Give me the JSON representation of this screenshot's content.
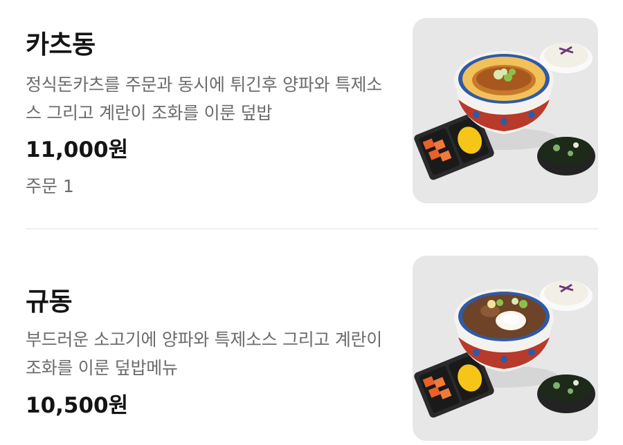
{
  "menu": {
    "items": [
      {
        "name": "카츠동",
        "description": "정식돈카츠를 주문과 동시에 튀긴후 양파와 특제소스 그리고 계란이 조화를 이룬 덮밥",
        "price": "11,000원",
        "orders": "주문 1"
      },
      {
        "name": "규동",
        "description": "부드러운 소고기에 양파와 특제소스 그리고 계란이 조화를 이룬 덮밥메뉴",
        "price": "10,500원"
      }
    ]
  },
  "colors": {
    "text_primary": "#141414",
    "text_secondary": "#6b6b6b",
    "divider": "#efefef",
    "photo_background": "#e7e7e7"
  }
}
